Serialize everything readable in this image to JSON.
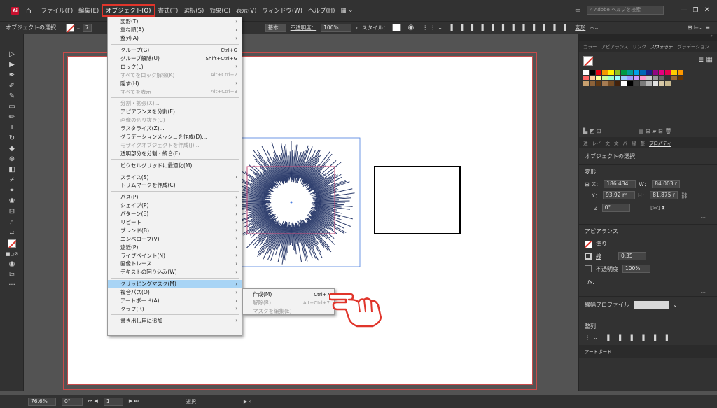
{
  "menubar": {
    "items": [
      "ファイル(F)",
      "編集(E)",
      "オブジェクト(O)",
      "書式(T)",
      "選択(S)",
      "効果(C)",
      "表示(V)",
      "ウィンドウ(W)",
      "ヘルプ(H)"
    ],
    "search_placeholder": "Adobe ヘルプを検索"
  },
  "controlbar": {
    "selection_label": "オブジェクトの選択",
    "stroke_basic": "基本",
    "opacity_label": "不透明度：",
    "opacity_value": "100%",
    "style_label": "スタイル：",
    "transform": "変形",
    "stroke_weight": "7"
  },
  "dropdown": {
    "items": [
      {
        "label": "変形(T)",
        "arrow": true
      },
      {
        "label": "重ね順(A)",
        "arrow": true
      },
      {
        "label": "整列(A)",
        "arrow": true
      },
      {
        "sep": true
      },
      {
        "label": "グループ(G)",
        "shortcut": "Ctrl+G"
      },
      {
        "label": "グループ解除(U)",
        "shortcut": "Shift+Ctrl+G"
      },
      {
        "label": "ロック(L)",
        "arrow": true
      },
      {
        "label": "すべてをロック解除(K)",
        "shortcut": "Alt+Ctrl+2",
        "disabled": true
      },
      {
        "label": "隠す(H)",
        "arrow": true
      },
      {
        "label": "すべてを表示",
        "shortcut": "Alt+Ctrl+3",
        "disabled": true
      },
      {
        "sep": true
      },
      {
        "label": "分割・拡張(X)...",
        "disabled": true
      },
      {
        "label": "アピアランスを分割(E)"
      },
      {
        "label": "画像の切り抜き(C)",
        "disabled": true
      },
      {
        "label": "ラスタライズ(Z)..."
      },
      {
        "label": "グラデーションメッシュを作成(D)..."
      },
      {
        "label": "モザイクオブジェクトを作成(J)...",
        "disabled": true
      },
      {
        "label": "透明部分を分割・統合(F)..."
      },
      {
        "sep": true
      },
      {
        "label": "ピクセルグリッドに最適化(M)"
      },
      {
        "sep": true
      },
      {
        "label": "スライス(S)",
        "arrow": true
      },
      {
        "label": "トリムマークを作成(C)"
      },
      {
        "sep": true
      },
      {
        "label": "パス(P)",
        "arrow": true
      },
      {
        "label": "シェイプ(P)",
        "arrow": true
      },
      {
        "label": "パターン(E)",
        "arrow": true
      },
      {
        "label": "リピート",
        "arrow": true
      },
      {
        "label": "ブレンド(B)",
        "arrow": true
      },
      {
        "label": "エンベロープ(V)",
        "arrow": true
      },
      {
        "label": "遠近(P)",
        "arrow": true
      },
      {
        "label": "ライブペイント(N)",
        "arrow": true
      },
      {
        "label": "画像トレース",
        "arrow": true
      },
      {
        "label": "テキストの回り込み(W)",
        "arrow": true
      },
      {
        "sep": true
      },
      {
        "label": "クリッピングマスク(M)",
        "arrow": true,
        "highlight": true
      },
      {
        "label": "複合パス(O)",
        "arrow": true
      },
      {
        "label": "アートボード(A)",
        "arrow": true
      },
      {
        "label": "グラフ(R)",
        "arrow": true
      },
      {
        "sep": true
      },
      {
        "label": "書き出し用に追加",
        "arrow": true
      }
    ]
  },
  "submenu": {
    "items": [
      {
        "label": "作成(M)",
        "shortcut": "Ctrl+7"
      },
      {
        "label": "解除(R)",
        "shortcut": "Alt+Ctrl+7",
        "disabled": true
      },
      {
        "label": "マスクを編集(E)",
        "disabled": true
      }
    ]
  },
  "panels": {
    "swatch_tabs": [
      "カラー",
      "アピアランス",
      "リンク",
      "スウォッチ",
      "グラデーション"
    ],
    "active_swatch_tab": "スウォッチ",
    "prop_tabs": [
      "透",
      "レイ",
      "文",
      "文",
      "パ",
      "線",
      "整",
      "プロパティ"
    ],
    "active_prop_tab": "プロパティ",
    "object_select": "オブジェクトの選択",
    "transform_label": "変形",
    "x": "186.434",
    "y": "93.92 m",
    "w": "84.003 r",
    "h": "81.875 r",
    "x_label": "X：",
    "y_label": "Y：",
    "w_label": "W：",
    "h_label": "H：",
    "angle": "0°",
    "appearance_label": "アピアランス",
    "fill_label": "塗り",
    "stroke_label": "線",
    "stroke_value": "0.35",
    "opacity_label": "不透明度",
    "opacity_value": "100%",
    "fx": "fx.",
    "brush_label": "線幅プロファイル",
    "align_label": "整列",
    "artboard_label": "アートボード"
  },
  "status": {
    "zoom": "76.6%",
    "rotation": "0°",
    "artboard_num": "1",
    "tool_label": "選択"
  },
  "swatch_colors": [
    "#ffffff",
    "#000000",
    "#e60012",
    "#f39800",
    "#fff100",
    "#8fc31f",
    "#009944",
    "#009e96",
    "#00a0e9",
    "#0068b7",
    "#1d2088",
    "#920783",
    "#e4007f",
    "#e5004f",
    "#ffcc00",
    "#ff9900",
    "#ff6666",
    "#ffcc99",
    "#ffff99",
    "#ccff99",
    "#99ffcc",
    "#99ffff",
    "#99ccff",
    "#9999ff",
    "#cc99ff",
    "#ff99cc",
    "#cccccc",
    "#999999",
    "#666666",
    "#333333",
    "#996633",
    "#663300",
    "#c8a06e",
    "#8c6239",
    "#603813",
    "#a67c52",
    "#754c24",
    "#42210b",
    "#ffffff",
    "#000000",
    "#3f3f3f",
    "#7a7a7a",
    "#b5b5b5",
    "#e1e1e1",
    "#d7c9a7",
    "#c8b98f"
  ]
}
